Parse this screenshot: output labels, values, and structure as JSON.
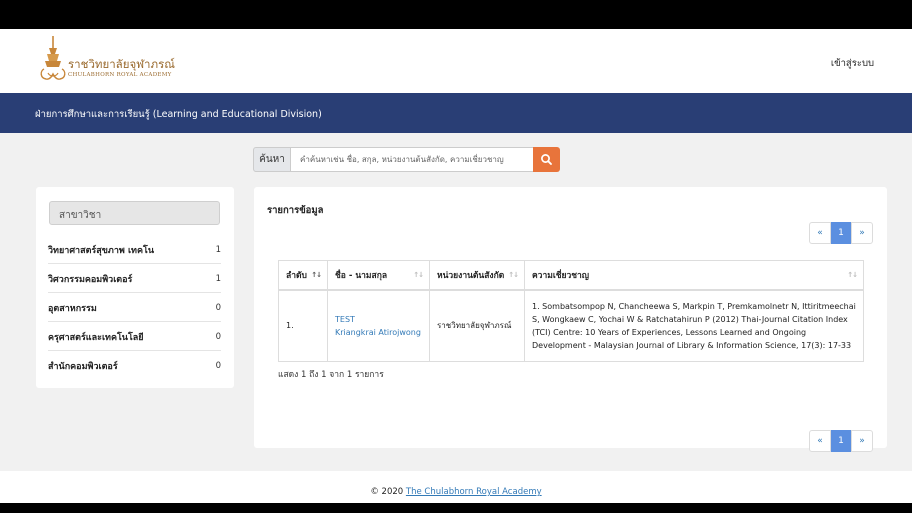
{
  "header": {
    "logo_th": "ราชวิทยาลัยจุฬาภรณ์",
    "logo_en": "CHULABHORN ROYAL ACADEMY",
    "login_label": "เข้าสู่ระบบ"
  },
  "banner": {
    "title": "ฝ่ายการศึกษาและการเรียนรู้ (Learning and Educational Division)"
  },
  "search": {
    "label": "ค้นหา",
    "placeholder": "คำค้นหาเช่น ชื่อ, สกุล, หน่วยงานต้นสังกัด, ความเชี่ยวชาญ",
    "value": ""
  },
  "sidebar": {
    "heading": "สาขาวิชา",
    "items": [
      {
        "label": "วิทยาศาสตร์สุขภาพ เทคโน",
        "count": "1"
      },
      {
        "label": "วิศวกรรมคอมพิวเตอร์",
        "count": "1"
      },
      {
        "label": "อุตสาหกรรม",
        "count": "0"
      },
      {
        "label": "ครุศาสตร์และเทคโนโลยี",
        "count": "0"
      },
      {
        "label": "สำนักคอมพิวเตอร์",
        "count": "0"
      }
    ]
  },
  "main": {
    "title": "รายการข้อมูล",
    "pagination": {
      "prev": "«",
      "current": "1",
      "next": "»"
    },
    "table": {
      "headers": [
        "ลำดับ",
        "ชื่อ - นามสกุล",
        "หน่วยงานต้นสังกัด",
        "ความเชี่ยวชาญ"
      ],
      "rows": [
        {
          "no": "1.",
          "name_line1": "TEST",
          "name_line2": "Kriangkrai Atirojwong",
          "agency": "ราชวิทยาลัยจุฬาภรณ์",
          "expertise": "1. Sombatsompop N, Chancheewa S, Markpin T, Premkamolnetr N, Ittiritmeechai S, Wongkaew C, Yochai W & Ratchatahirun P (2012) Thai-Journal Citation Index (TCI) Centre: 10 Years of Experiences, Lessons Learned and Ongoing Development - Malaysian Journal of Library & Information Science, 17(3): 17-33"
        }
      ]
    },
    "info": "แสดง 1 ถึง 1 จาก 1 รายการ"
  },
  "footer": {
    "copyright": "© 2020",
    "link": "The Chulabhorn Royal Academy"
  },
  "colors": {
    "banner": "#293e75",
    "accent": "#e8743b",
    "link": "#337ab7",
    "page_active": "#5b8fe0"
  }
}
